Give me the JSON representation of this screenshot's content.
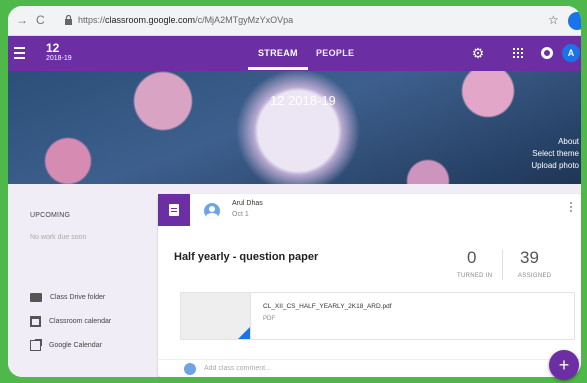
{
  "browser": {
    "back": "→",
    "reload": "C",
    "url_scheme": "https://",
    "url_host": "classroom.google.com",
    "url_path": "/c/MjA2MTgyMzYxOVpa",
    "star": "☆"
  },
  "app_bar": {
    "class_name": "12",
    "class_section": "2018-19",
    "tabs": [
      {
        "label": "STREAM"
      },
      {
        "label": "PEOPLE"
      }
    ],
    "gear": "⚙",
    "avatar_letter": "A"
  },
  "banner": {
    "title": "12  2018-19",
    "links": [
      "About",
      "Select theme",
      "Upload photo"
    ]
  },
  "sidebar": {
    "upcoming_title": "UPCOMING",
    "no_work": "No work due soon",
    "links": [
      {
        "label": "Class Drive folder",
        "icon": "folder-icon"
      },
      {
        "label": "Classroom calendar",
        "icon": "calendar-icon"
      },
      {
        "label": "Google Calendar",
        "icon": "external-link-icon"
      }
    ]
  },
  "post": {
    "author": "Arul Dhas",
    "date": "Oct 1",
    "title": "Half yearly - question paper",
    "stats": [
      {
        "value": "0",
        "label": "TURNED IN"
      },
      {
        "value": "39",
        "label": "ASSIGNED"
      }
    ],
    "attachment": {
      "file_name": "CL_XII_CS_HALF_YEARLY_2K18_ARD.pdf",
      "file_type": "PDF"
    },
    "comment_placeholder": "Add class comment..."
  },
  "fab_label": "+",
  "colors": {
    "theme": "#6b2fa3",
    "frame_border": "#4fb84a",
    "accent_blue": "#1a73e8"
  }
}
